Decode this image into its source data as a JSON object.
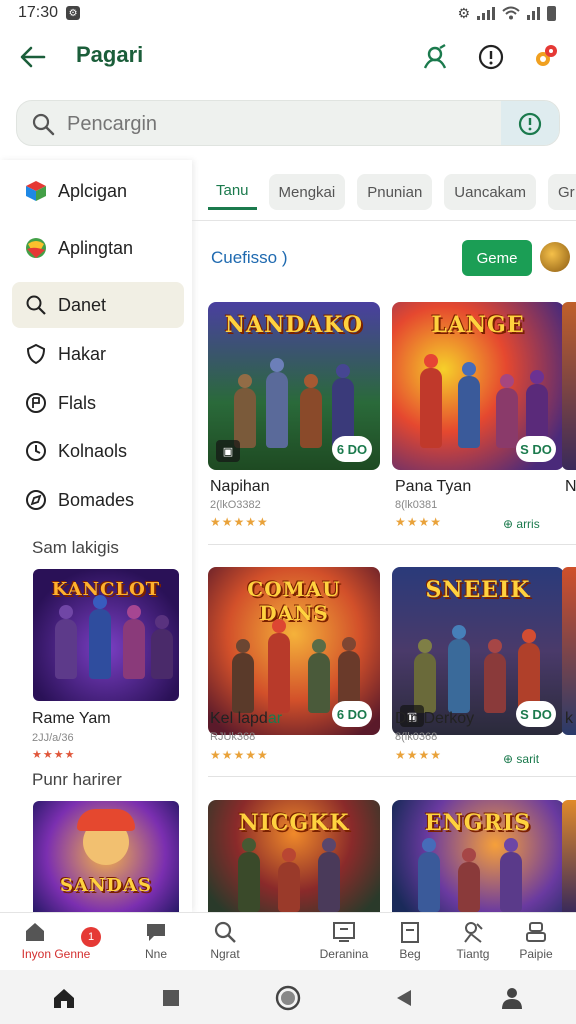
{
  "status_bar": {
    "time": "17:30",
    "notif_glyph": "⚙",
    "right_glyph": "⚙"
  },
  "header": {
    "title": "Pagari",
    "icons": [
      "back-arrow-icon",
      "discover-icon",
      "info-icon",
      "notification-icon"
    ]
  },
  "search": {
    "placeholder": "Pencargin"
  },
  "sidebar": {
    "items": [
      {
        "label": "Aplcigan",
        "icon": "apps-icon"
      },
      {
        "label": "Aplingtan",
        "icon": "games-icon"
      },
      {
        "label": "Danet",
        "icon": "search-icon",
        "active": true
      },
      {
        "label": "Hakar",
        "icon": "shield-icon"
      },
      {
        "label": "Flals",
        "icon": "flag-icon"
      },
      {
        "label": "Kolnaols",
        "icon": "clock-icon"
      },
      {
        "label": "Bomades",
        "icon": "compass-icon"
      }
    ],
    "section1": "Sam lakigis",
    "card1": {
      "banner": "KANCLOT",
      "title": "Rame Yam",
      "sub": "2JJ/a/36",
      "stars": "★★★★"
    },
    "section2": "Punr harirer",
    "card2": {
      "banner": "SANDAS"
    }
  },
  "tabs": [
    {
      "label": "Tanu",
      "active": true
    },
    {
      "label": "Mengkai"
    },
    {
      "label": "Pnunian"
    },
    {
      "label": "Uancakam"
    },
    {
      "label": "Gr"
    }
  ],
  "section": {
    "title": "Cuefisso )",
    "button": "Geme"
  },
  "games": [
    {
      "banner": "NANDAKO",
      "title": "Napihan",
      "sub": "2(lkO3382",
      "stars": "★★★★★",
      "price": "6 DO",
      "status": ""
    },
    {
      "banner": "LANGE",
      "title": "Pana Tyan",
      "sub": "8(lk0381",
      "stars": "★★★★",
      "price": "S DO",
      "status": "arris"
    },
    {
      "banner": "COMAU DANS",
      "title": "Kel lapd",
      "title_accent": "ar",
      "sub": "RJUk368",
      "stars": "★★★★★",
      "price": "6 DO",
      "status": ""
    },
    {
      "banner": "SNEEIK",
      "title": "Din Derkoy",
      "sub": "8(lk0368",
      "stars": "★★★★",
      "price": "S DO",
      "status": "sarit"
    },
    {
      "banner": "NICGKK",
      "title": "",
      "sub": "",
      "stars": "",
      "price": "",
      "status": ""
    },
    {
      "banner": "ENGRIS",
      "title": "",
      "sub": "",
      "stars": "",
      "price": "",
      "status": ""
    }
  ],
  "edge_peek": {
    "r1": "N",
    "r2": "k"
  },
  "bottom_nav": [
    {
      "label": "Inyon Genne",
      "icon": "home-icon",
      "active": true,
      "badge": "1"
    },
    {
      "label": "Nne",
      "icon": "chat-icon"
    },
    {
      "label": "Ngrat",
      "icon": "search-icon"
    },
    {
      "label": "Deranina",
      "icon": "library-icon"
    },
    {
      "label": "Beg",
      "icon": "bag-icon"
    },
    {
      "label": "Tiantg",
      "icon": "trending-icon"
    },
    {
      "label": "Paipie",
      "icon": "profile-icon"
    }
  ],
  "colors": {
    "accent": "#1b7a4d",
    "button": "#1b9e55",
    "link": "#1f6ab0",
    "active_tab": "#d32f2f"
  }
}
